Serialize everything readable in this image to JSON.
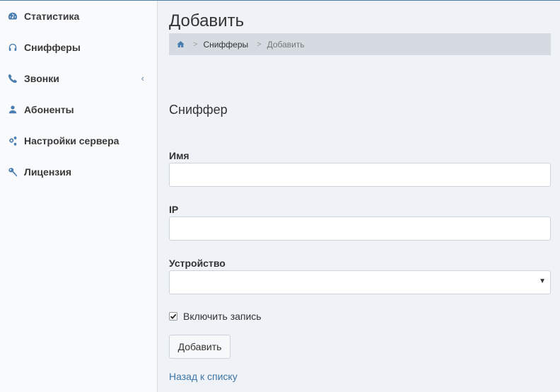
{
  "sidebar": {
    "items": [
      {
        "label": "Статистика",
        "icon": "dashboard-icon"
      },
      {
        "label": "Снифферы",
        "icon": "headphones-icon"
      },
      {
        "label": "Звонки",
        "icon": "phone-icon"
      },
      {
        "label": "Абоненты",
        "icon": "user-icon"
      },
      {
        "label": "Настройки сервера",
        "icon": "cogs-icon"
      },
      {
        "label": "Лицензия",
        "icon": "key-icon"
      }
    ]
  },
  "page": {
    "title": "Добавить"
  },
  "breadcrumb": {
    "home_icon": "home-icon",
    "items": [
      "Снифферы",
      "Добавить"
    ]
  },
  "form": {
    "section_title": "Сниффер",
    "name_label": "Имя",
    "name_value": "",
    "ip_label": "IP",
    "ip_value": "",
    "device_label": "Устройство",
    "device_value": "",
    "record_label": "Включить запись",
    "record_checked": true,
    "submit_label": "Добавить",
    "back_label": "Назад к списку"
  },
  "colors": {
    "accent": "#4a7db0",
    "link": "#3d74a6",
    "sidebar_bg": "#f9fafc",
    "main_bg": "#eff2f6",
    "breadcrumb_bg": "#d6dbe2"
  }
}
